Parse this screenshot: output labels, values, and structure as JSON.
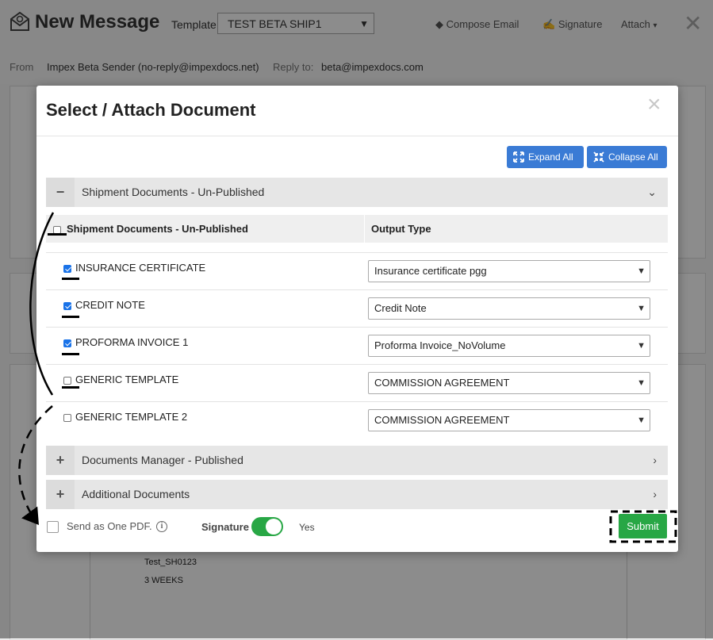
{
  "background": {
    "title": "New Message",
    "template_label": "Template",
    "template_value": "TEST BETA SHIP1",
    "compose_email": "Compose Email",
    "signature": "Signature",
    "attach": "Attach",
    "from_label": "From",
    "from_value": "Impex Beta Sender (no-reply@impexdocs.net)",
    "reply_label": "Reply to:",
    "reply_value": "beta@impexdocs.com",
    "body_line1": "Test_SH0123",
    "body_line2": "3 WEEKS"
  },
  "modal": {
    "title": "Select / Attach Document",
    "close": "×",
    "expand_all": "Expand All",
    "collapse_all": "Collapse All",
    "sections": [
      {
        "toggle": "−",
        "label": "Shipment Documents - Un-Published",
        "expanded": true
      },
      {
        "toggle": "+",
        "label": "Documents Manager - Published",
        "expanded": false
      },
      {
        "toggle": "+",
        "label": "Additional Documents",
        "expanded": false
      }
    ],
    "table": {
      "col1": "Shipment Documents - Un-Published",
      "col2": "Output Type",
      "rows": [
        {
          "name": "INSURANCE CERTIFICATE",
          "checked": true,
          "output": "Insurance certificate pgg"
        },
        {
          "name": "CREDIT NOTE",
          "checked": true,
          "output": "Credit Note"
        },
        {
          "name": "PROFORMA INVOICE 1",
          "checked": true,
          "output": "Proforma Invoice_NoVolume"
        },
        {
          "name": "GENERIC TEMPLATE",
          "checked": false,
          "output": "COMMISSION AGREEMENT"
        },
        {
          "name": "GENERIC TEMPLATE 2",
          "checked": false,
          "output": "COMMISSION AGREEMENT"
        }
      ]
    },
    "footer": {
      "send_as_one_pdf": "Send as One PDF.",
      "signature_label": "Signature",
      "signature_value": "Yes",
      "submit": "Submit"
    }
  },
  "colors": {
    "accent_blue": "#3a7bd5",
    "submit_green": "#28a745",
    "checkbox_blue": "#1a73e8"
  }
}
